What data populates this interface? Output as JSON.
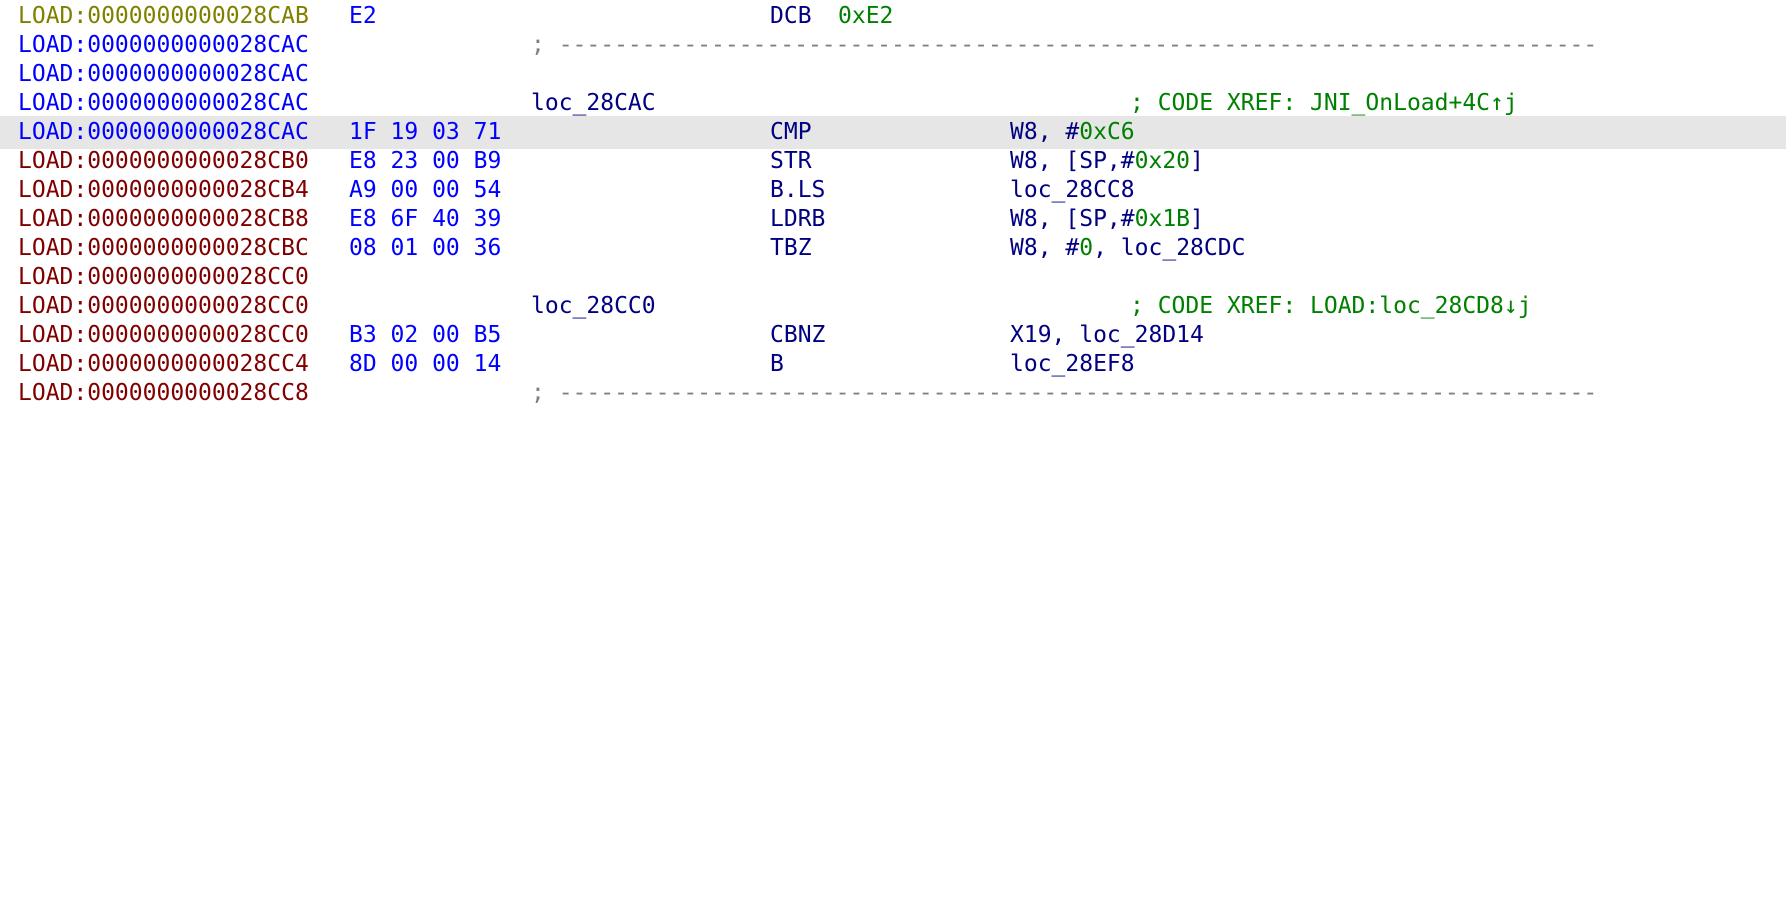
{
  "disassembly": {
    "colors": {
      "address_data": "#808000",
      "address_code": "#0000ff",
      "address_no_code": "#800000",
      "opcode_bytes": "#0000ff",
      "instruction": "#000080",
      "number": "#008000",
      "comment": "#008000",
      "separator": "#808080",
      "selected_line_bg": "#e6e6e6"
    },
    "lines": [
      {
        "address": "LOAD:0000000000028CAB",
        "bytes": "E2",
        "mnemonic": "DCB",
        "operand_num": "0xE2"
      },
      {
        "address": "LOAD:0000000000028CAC",
        "separator": "; ---------------------------------------------------------------------------"
      },
      {
        "address": "LOAD:0000000000028CAC"
      },
      {
        "address": "LOAD:0000000000028CAC",
        "label": "loc_28CAC",
        "comment": "; CODE XREF: JNI_OnLoad+4C↑j"
      },
      {
        "address": "LOAD:0000000000028CAC",
        "bytes": "1F 19 03 71",
        "mnemonic": "CMP",
        "operands": {
          "a": "W8, #",
          "b": "0xC6",
          "c": ""
        }
      },
      {
        "address": "LOAD:0000000000028CB0",
        "bytes": "E8 23 00 B9",
        "mnemonic": "STR",
        "operands": {
          "a": "W8, [SP,#",
          "b": "0x20",
          "c": "]"
        }
      },
      {
        "address": "LOAD:0000000000028CB4",
        "bytes": "A9 00 00 54",
        "mnemonic": "B.LS",
        "operands": {
          "a": "loc_28CC8",
          "b": "",
          "c": ""
        }
      },
      {
        "address": "LOAD:0000000000028CB8",
        "bytes": "E8 6F 40 39",
        "mnemonic": "LDRB",
        "operands": {
          "a": "W8, [SP,#",
          "b": "0x1B",
          "c": "]"
        }
      },
      {
        "address": "LOAD:0000000000028CBC",
        "bytes": "08 01 00 36",
        "mnemonic": "TBZ",
        "operands": {
          "a": "W8, #",
          "b": "0",
          "c": ", loc_28CDC"
        }
      },
      {
        "address": "LOAD:0000000000028CC0"
      },
      {
        "address": "LOAD:0000000000028CC0",
        "label": "loc_28CC0",
        "comment": "; CODE XREF: LOAD:loc_28CD8↓j"
      },
      {
        "address": "LOAD:0000000000028CC0",
        "bytes": "B3 02 00 B5",
        "mnemonic": "CBNZ",
        "operands": {
          "a": "X19, loc_28D14",
          "b": "",
          "c": ""
        }
      },
      {
        "address": "LOAD:0000000000028CC4",
        "bytes": "8D 00 00 14",
        "mnemonic": "B",
        "operands": {
          "a": "loc_28EF8",
          "b": "",
          "c": ""
        }
      },
      {
        "address": "LOAD:0000000000028CC8",
        "separator": "; ---------------------------------------------------------------------------"
      }
    ]
  }
}
